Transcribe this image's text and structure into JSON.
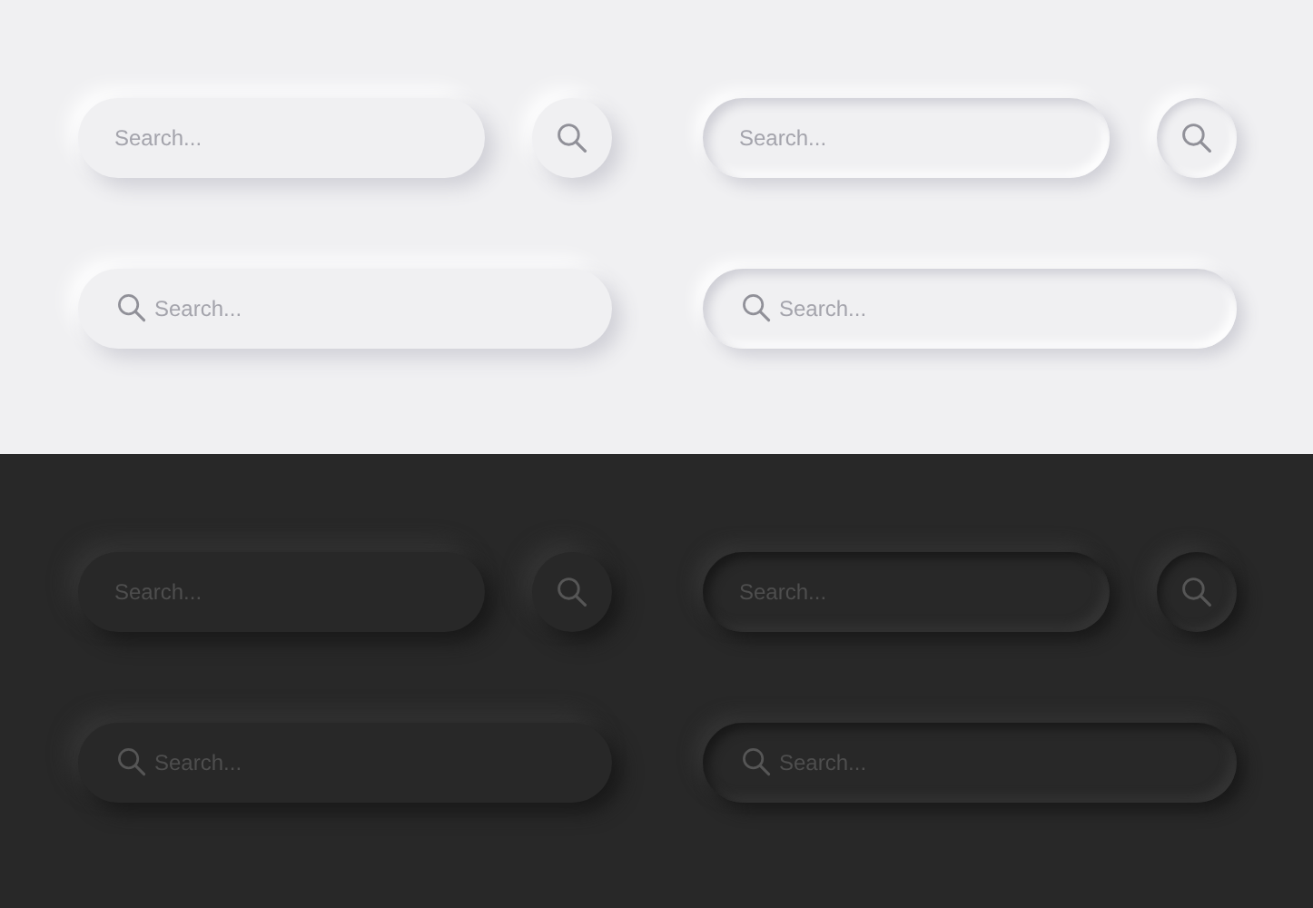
{
  "panels": [
    {
      "variants": [
        {
          "compact": {
            "placeholder": "Search..."
          },
          "wide": {
            "placeholder": "Search..."
          }
        },
        {
          "compact": {
            "placeholder": "Search..."
          },
          "wide": {
            "placeholder": "Search..."
          }
        }
      ]
    },
    {
      "variants": [
        {
          "compact": {
            "placeholder": "Search..."
          },
          "wide": {
            "placeholder": "Search..."
          }
        },
        {
          "compact": {
            "placeholder": "Search..."
          },
          "wide": {
            "placeholder": "Search..."
          }
        }
      ]
    }
  ]
}
